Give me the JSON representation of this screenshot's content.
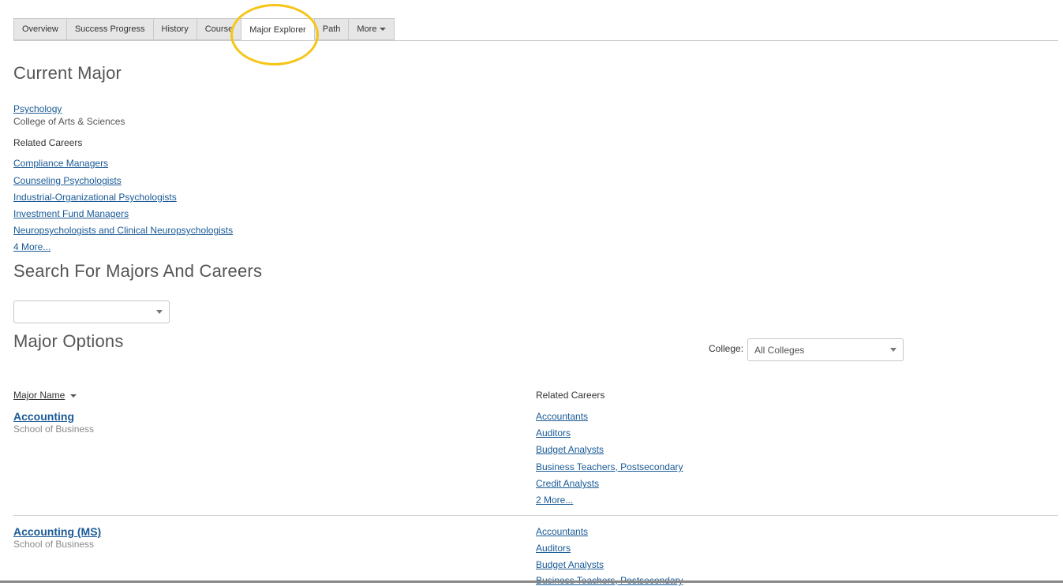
{
  "tabs": [
    {
      "label": "Overview"
    },
    {
      "label": "Success Progress"
    },
    {
      "label": "History"
    },
    {
      "label": "Course"
    },
    {
      "label": "Major Explorer"
    },
    {
      "label": "Path"
    },
    {
      "label": "More"
    }
  ],
  "current_major": {
    "heading": "Current Major",
    "major_name": "Psychology",
    "college": "College of Arts & Sciences",
    "related_label": "Related Careers",
    "careers": [
      "Compliance Managers",
      "Counseling Psychologists",
      "Industrial-Organizational Psychologists",
      "Investment Fund Managers",
      "Neuropsychologists and Clinical Neuropsychologists"
    ],
    "more_link": "4 More..."
  },
  "search": {
    "heading": "Search For Majors And Careers",
    "value": ""
  },
  "major_options": {
    "heading": "Major Options",
    "college_label": "College:",
    "college_selected": "All Colleges",
    "col_major": "Major Name",
    "col_careers": "Related Careers",
    "rows": [
      {
        "name": "Accounting",
        "school": "School of Business",
        "careers": [
          "Accountants",
          "Auditors",
          "Budget Analysts",
          "Business Teachers, Postsecondary",
          "Credit Analysts"
        ],
        "more": "2 More..."
      },
      {
        "name": "Accounting (MS)",
        "school": "School of Business",
        "careers": [
          "Accountants",
          "Auditors",
          "Budget Analysts",
          "Business Teachers, Postsecondary"
        ]
      }
    ]
  },
  "colors": {
    "link": "#1a5a96",
    "highlight": "#f5c518"
  }
}
